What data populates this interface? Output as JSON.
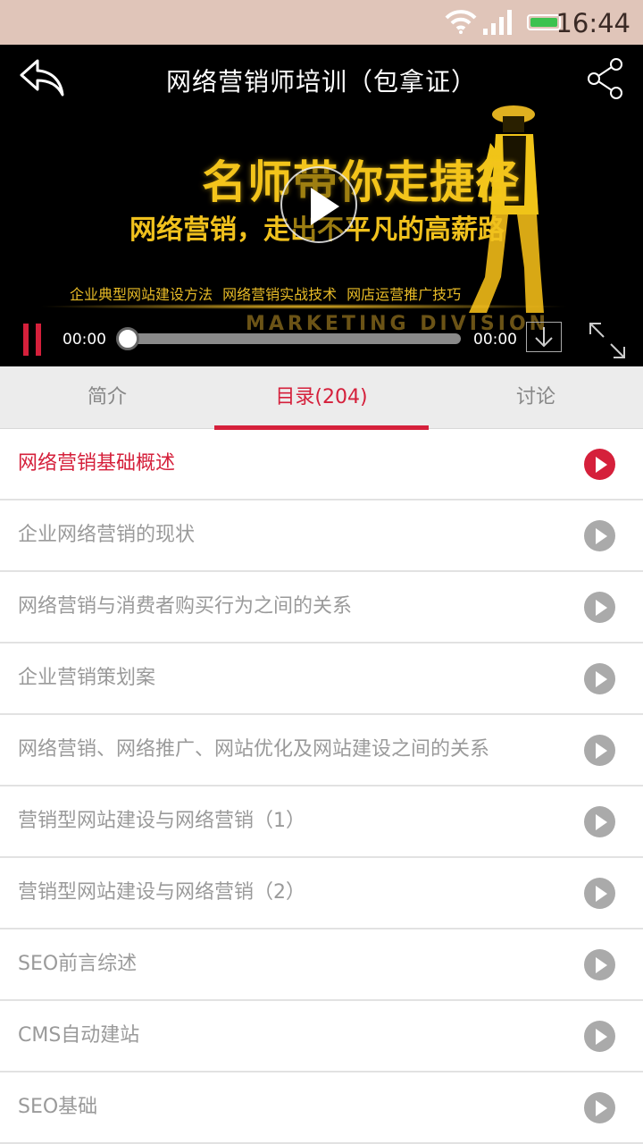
{
  "status_bar": {
    "time": "16:44"
  },
  "player": {
    "title": "网络营销师培训（包拿证）",
    "poster_headline": "名师带你走捷径",
    "poster_subline": "网络营销，走出不平凡的高薪路",
    "poster_topics": "企业典型网站建设方法  网络营销实战技术  网店运营推广技巧",
    "poster_brand": "MARKETING DIVISION",
    "current_time": "00:00",
    "total_time": "00:00",
    "progress": 0
  },
  "tabs": [
    {
      "label": "简介"
    },
    {
      "label": "目录(204)"
    },
    {
      "label": "讨论"
    }
  ],
  "active_tab_index": 1,
  "lessons": [
    {
      "title": "网络营销基础概述",
      "active": true
    },
    {
      "title": "企业网络营销的现状"
    },
    {
      "title": "网络营销与消费者购买行为之间的关系"
    },
    {
      "title": "企业营销策划案"
    },
    {
      "title": "网络营销、网络推广、网站优化及网站建设之间的关系"
    },
    {
      "title": "营销型网站建设与网络营销（1）"
    },
    {
      "title": "营销型网站建设与网络营销（2）"
    },
    {
      "title": "SEO前言综述"
    },
    {
      "title": "CMS自动建站"
    },
    {
      "title": "SEO基础"
    }
  ],
  "colors": {
    "accent": "#d5203b",
    "status_bar": "#e0c5b9",
    "inactive": "#9a9a9a"
  }
}
